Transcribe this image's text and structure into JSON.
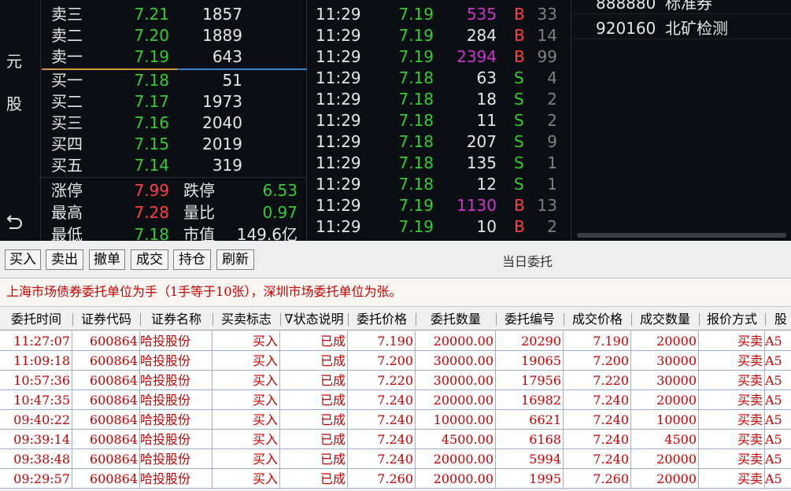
{
  "side": {
    "chars": [
      "元",
      "股"
    ]
  },
  "order_book": {
    "asks": [
      {
        "label": "卖三",
        "price": "7.21",
        "volume": "1857"
      },
      {
        "label": "卖二",
        "price": "7.20",
        "volume": "1889"
      },
      {
        "label": "卖一",
        "price": "7.19",
        "volume": "643"
      }
    ],
    "bids": [
      {
        "label": "买一",
        "price": "7.18",
        "volume": "51"
      },
      {
        "label": "买二",
        "price": "7.17",
        "volume": "1973"
      },
      {
        "label": "买三",
        "price": "7.16",
        "volume": "2040"
      },
      {
        "label": "买四",
        "price": "7.15",
        "volume": "2019"
      },
      {
        "label": "买五",
        "price": "7.14",
        "volume": "319"
      }
    ]
  },
  "stats": [
    {
      "label1": "涨停",
      "value1": "7.99",
      "label2": "跌停",
      "value2": "6.53"
    },
    {
      "label1": "最高",
      "value1": "7.28",
      "label2": "量比",
      "value2": "0.97"
    },
    {
      "label1": "最低",
      "value1": "7.18",
      "label2": "市值",
      "value2": "149.6亿"
    }
  ],
  "ticks": [
    {
      "time": "11:29",
      "price": "7.19",
      "volume": "535",
      "side": "B",
      "count": "33",
      "big": true
    },
    {
      "time": "11:29",
      "price": "7.19",
      "volume": "284",
      "side": "B",
      "count": "14",
      "big": false
    },
    {
      "time": "11:29",
      "price": "7.19",
      "volume": "2394",
      "side": "B",
      "count": "99",
      "big": true
    },
    {
      "time": "11:29",
      "price": "7.18",
      "volume": "63",
      "side": "S",
      "count": "4",
      "big": false
    },
    {
      "time": "11:29",
      "price": "7.18",
      "volume": "18",
      "side": "S",
      "count": "2",
      "big": false
    },
    {
      "time": "11:29",
      "price": "7.18",
      "volume": "11",
      "side": "S",
      "count": "2",
      "big": false
    },
    {
      "time": "11:29",
      "price": "7.18",
      "volume": "207",
      "side": "S",
      "count": "9",
      "big": false
    },
    {
      "time": "11:29",
      "price": "7.18",
      "volume": "135",
      "side": "S",
      "count": "1",
      "big": false
    },
    {
      "time": "11:29",
      "price": "7.18",
      "volume": "12",
      "side": "S",
      "count": "1",
      "big": false
    },
    {
      "time": "11:29",
      "price": "7.19",
      "volume": "1130",
      "side": "B",
      "count": "13",
      "big": true
    },
    {
      "time": "11:29",
      "price": "7.19",
      "volume": "10",
      "side": "B",
      "count": "2",
      "big": false
    }
  ],
  "stock_list": [
    {
      "code": "888880",
      "name": "标准券"
    },
    {
      "code": "920160",
      "name": "北矿检测"
    }
  ],
  "toolbar": {
    "buy": "买入",
    "sell": "卖出",
    "cancel": "撤单",
    "deals": "成交",
    "positions": "持仓",
    "refresh": "刷新",
    "title": "当日委托"
  },
  "notice": "上海市场债券委托单位为手（1手等于10张），深圳市场委托单位为张。",
  "table": {
    "headers": [
      "委托时间",
      "证券代码",
      "证券名称",
      "买卖标志",
      "∇状态说明",
      "委托价格",
      "委托数量",
      "委托编号",
      "成交价格",
      "成交数量",
      "报价方式",
      "股"
    ],
    "rows": [
      [
        "11:27:07",
        "600864",
        "哈投股份",
        "买入",
        "已成",
        "7.190",
        "20000.00",
        "20290",
        "7.190",
        "20000",
        "买卖",
        "A5"
      ],
      [
        "11:09:18",
        "600864",
        "哈投股份",
        "买入",
        "已成",
        "7.200",
        "30000.00",
        "19065",
        "7.200",
        "30000",
        "买卖",
        "A5"
      ],
      [
        "10:57:36",
        "600864",
        "哈投股份",
        "买入",
        "已成",
        "7.220",
        "30000.00",
        "17956",
        "7.220",
        "30000",
        "买卖",
        "A5"
      ],
      [
        "10:47:35",
        "600864",
        "哈投股份",
        "买入",
        "已成",
        "7.240",
        "20000.00",
        "16982",
        "7.240",
        "20000",
        "买卖",
        "A5"
      ],
      [
        "09:40:22",
        "600864",
        "哈投股份",
        "买入",
        "已成",
        "7.240",
        "10000.00",
        "6621",
        "7.240",
        "10000",
        "买卖",
        "A5"
      ],
      [
        "09:39:14",
        "600864",
        "哈投股份",
        "买入",
        "已成",
        "7.240",
        "4500.00",
        "6168",
        "7.240",
        "4500",
        "买卖",
        "A5"
      ],
      [
        "09:38:48",
        "600864",
        "哈投股份",
        "买入",
        "已成",
        "7.240",
        "20000.00",
        "5994",
        "7.240",
        "20000",
        "买卖",
        "A5"
      ],
      [
        "09:29:57",
        "600864",
        "哈投股份",
        "买入",
        "已成",
        "7.260",
        "20000.00",
        "1995",
        "7.260",
        "20000",
        "买卖",
        "A5"
      ]
    ]
  },
  "colors": {
    "up": "#ff4040",
    "down": "#33cc33",
    "big_volume": "#cc33cc",
    "order_text": "#cc0000"
  }
}
